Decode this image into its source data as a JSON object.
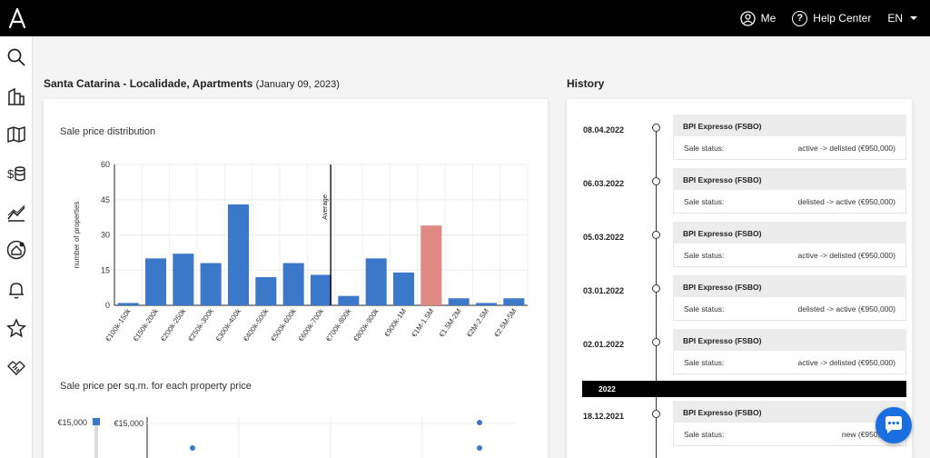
{
  "topbar": {
    "me_label": "Me",
    "help_label": "Help Center",
    "lang_label": "EN"
  },
  "sidebar": {
    "items": [
      "search-icon",
      "buildings-icon",
      "map-icon",
      "valuation-icon",
      "trends-icon",
      "home-alert-icon",
      "bell-icon",
      "star-icon",
      "handshake-icon"
    ]
  },
  "header": {
    "title": "Santa Catarina - Localidade, Apartments",
    "date": "(January 09, 2023)"
  },
  "history_title": "History",
  "chart1": {
    "title": "Sale price distribution",
    "chart_data": {
      "type": "bar",
      "categories": [
        "€100k-150k",
        "€150k-200k",
        "€200k-250k",
        "€250k-300k",
        "€300k-400k",
        "€400k-500k",
        "€500k-600k",
        "€600k-700k",
        "€700k-800k",
        "€800k-900k",
        "€900k-1M",
        "€1M-1.5M",
        "€1.5M-2M",
        "€2M-2.5M",
        "€2.5M-5M"
      ],
      "values": [
        1,
        20,
        22,
        18,
        43,
        12,
        18,
        13,
        4,
        20,
        14,
        34,
        3,
        1,
        3
      ],
      "highlight_index": 11,
      "ylabel": "number of properties",
      "ylim": [
        0,
        60
      ],
      "yticks": [
        "0",
        "15",
        "30",
        "45",
        "60"
      ],
      "average_label": "Average",
      "average_position": "between €600k-700k and €700k-800k",
      "bar_color": "#3b78c9",
      "highlight_color": "#df8884",
      "grid": true
    }
  },
  "chart2": {
    "title": "Sale price per sq.m. for each property price",
    "slider_label": "€15,000",
    "y_top_label": "€15,000"
  },
  "history": {
    "entries": [
      {
        "date": "08.04.2022",
        "source": "BPI Expresso (FSBO)",
        "status_label": "Sale status:",
        "status_value": "active -> delisted (€950,000)"
      },
      {
        "date": "06.03.2022",
        "source": "BPI Expresso (FSBO)",
        "status_label": "Sale status:",
        "status_value": "delisted -> active (€950,000)"
      },
      {
        "date": "05.03.2022",
        "source": "BPI Expresso (FSBO)",
        "status_label": "Sale status:",
        "status_value": "active -> delisted (€950,000)"
      },
      {
        "date": "03.01.2022",
        "source": "BPI Expresso (FSBO)",
        "status_label": "Sale status:",
        "status_value": "delisted -> active (€950,000)"
      },
      {
        "date": "02.01.2022",
        "source": "BPI Expresso (FSBO)",
        "status_label": "Sale status:",
        "status_value": "active -> delisted (€950,000)"
      },
      {
        "date": "18.12.2021",
        "source": "BPI Expresso (FSBO)",
        "status_label": "Sale status:",
        "status_value": "new (€950,000)"
      }
    ],
    "year_divider": "2022"
  },
  "colors": {
    "topbar": "#000000",
    "accent": "#3b78c9",
    "highlight": "#df8884",
    "chat": "#1a6fe0"
  }
}
